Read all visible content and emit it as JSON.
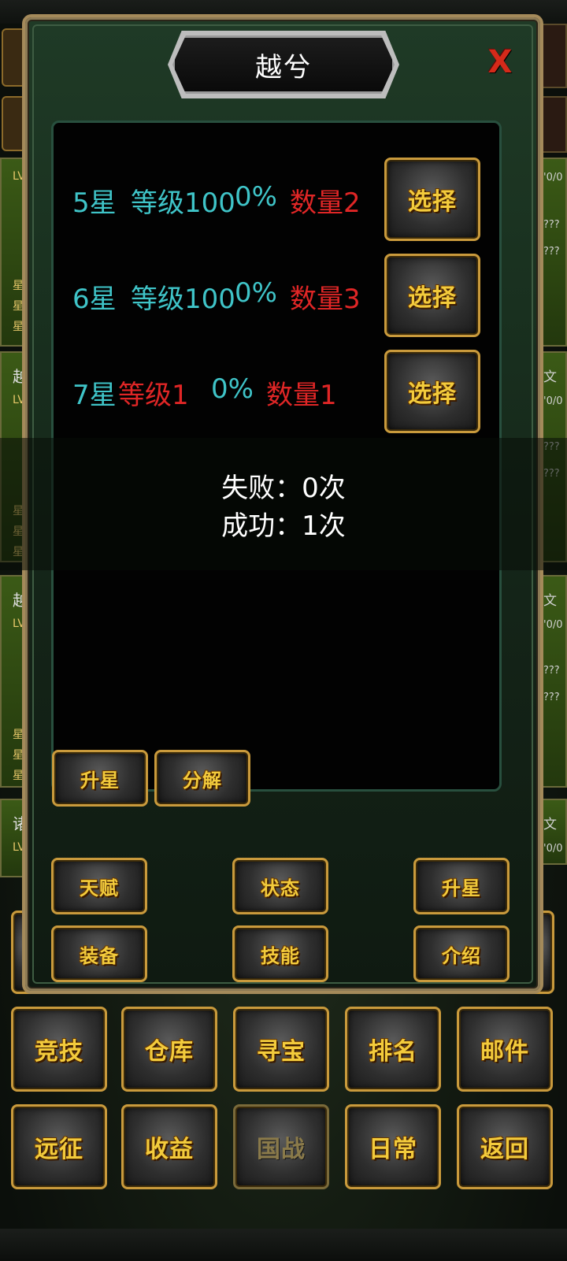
{
  "popup": {
    "title": "越兮",
    "close_label": "X"
  },
  "rows": [
    {
      "star": "5星",
      "level": "等级100",
      "percent": "0%",
      "count": "数量2",
      "button": "选择"
    },
    {
      "star": "6星",
      "level": "等级100",
      "percent": "0%",
      "count": "数量3",
      "button": "选择"
    },
    {
      "star": "7星",
      "level": "等级1",
      "percent": "0%",
      "count": "数量1",
      "button": "选择"
    }
  ],
  "result": {
    "fail": "失败：0次",
    "success": "成功：1次"
  },
  "panel_actions": {
    "upgrade_star": "升星",
    "decompose": "分解"
  },
  "hero_actions": {
    "talent": "天赋",
    "status": "状态",
    "upgrade_star": "升星",
    "equipment": "装备",
    "skills": "技能",
    "intro": "介绍"
  },
  "main_menu": {
    "arena": "竞技",
    "warehouse": "仓库",
    "treasure": "寻宝",
    "ranking": "排名",
    "mail": "邮件",
    "expedition": "远征",
    "income": "收益",
    "national_war": "国战",
    "daily": "日常",
    "back": "返回"
  },
  "background": {
    "left_cards": [
      {
        "lv": "LV",
        "s1": "星",
        "s2": "星",
        "s3": "星"
      },
      {
        "name": "越",
        "lv": "LV",
        "s1": "星",
        "s2": "星",
        "s3": "星"
      },
      {
        "name": "越",
        "lv": "LV",
        "s1": "星",
        "s2": "星",
        "s3": "星"
      },
      {
        "name": "诸",
        "lv": "LV"
      }
    ],
    "right_cards": [
      {
        "a": "'0/0",
        "b": "???",
        "c": "???"
      },
      {
        "a": "文",
        "b": "'0/0",
        "c": "???",
        "d": "???"
      },
      {
        "a": "文",
        "b": "'0/0",
        "c": "???",
        "d": "???"
      },
      {
        "a": "文",
        "b": "'0/0"
      }
    ]
  },
  "colors": {
    "cyan": "#3fc4c8",
    "red": "#e02626",
    "gold_text": "#f3cb3c",
    "gold_border": "#c99a3c"
  }
}
